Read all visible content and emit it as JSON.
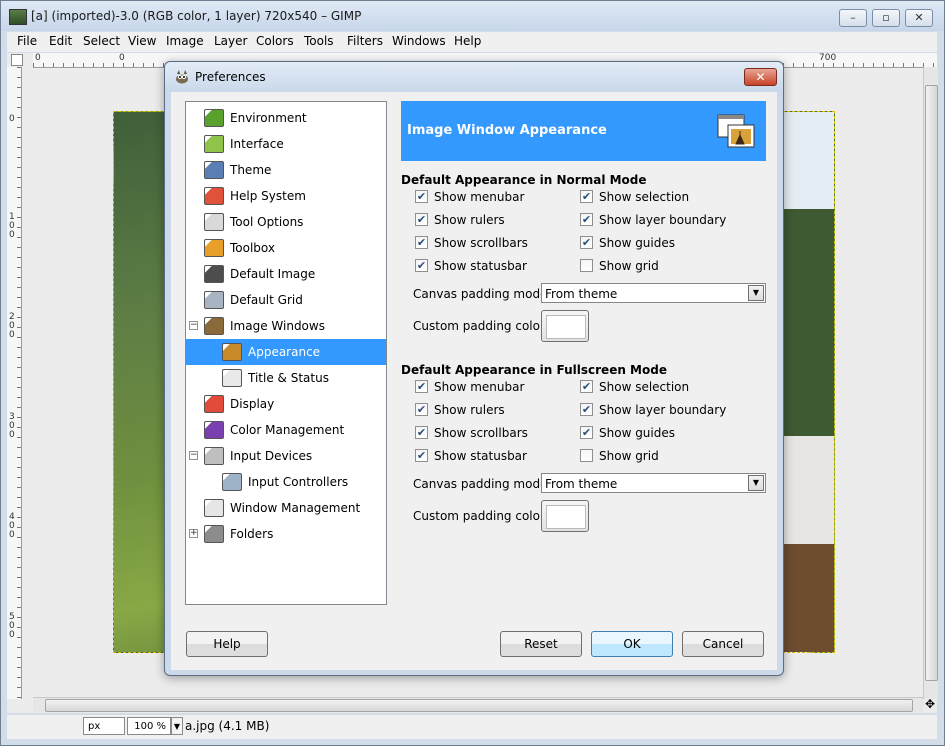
{
  "window": {
    "title": "[a] (imported)-3.0 (RGB color, 1 layer) 720x540 – GIMP",
    "minimize": "–",
    "maximize": "▫",
    "close": "✕"
  },
  "menubar": [
    "File",
    "Edit",
    "Select",
    "View",
    "Image",
    "Layer",
    "Colors",
    "Tools",
    "Filters",
    "Windows",
    "Help"
  ],
  "ruler": {
    "h_ticks": [
      "0",
      "0",
      "700"
    ],
    "v_ticks": [
      "0",
      "100",
      "200",
      "300",
      "400",
      "500"
    ]
  },
  "statusbar": {
    "unit": "px",
    "zoom": "100 %",
    "file_info": "a.jpg (4.1 MB)"
  },
  "dialog": {
    "title": "Preferences",
    "close": "✕",
    "tree": [
      {
        "label": "Environment",
        "level": 0,
        "icon": "environment-icon",
        "color": "#5aa02c"
      },
      {
        "label": "Interface",
        "level": 0,
        "icon": "interface-icon",
        "color": "#8fc34a"
      },
      {
        "label": "Theme",
        "level": 0,
        "icon": "theme-icon",
        "color": "#5b7fb5"
      },
      {
        "label": "Help System",
        "level": 0,
        "icon": "help-system-icon",
        "color": "#e0523a"
      },
      {
        "label": "Tool Options",
        "level": 0,
        "icon": "tool-options-icon",
        "color": "#d9d9d9"
      },
      {
        "label": "Toolbox",
        "level": 0,
        "icon": "toolbox-icon",
        "color": "#e8a02a"
      },
      {
        "label": "Default Image",
        "level": 0,
        "icon": "default-image-icon",
        "color": "#4d4d4d"
      },
      {
        "label": "Default Grid",
        "level": 0,
        "icon": "default-grid-icon",
        "color": "#a9b4c2"
      },
      {
        "label": "Image Windows",
        "level": 0,
        "expander": "−",
        "icon": "image-windows-icon",
        "color": "#8a6a3a"
      },
      {
        "label": "Appearance",
        "level": 1,
        "selected": true,
        "icon": "appearance-icon",
        "color": "#c98a2a"
      },
      {
        "label": "Title & Status",
        "level": 1,
        "icon": "title-status-icon",
        "color": "#e9e9e9"
      },
      {
        "label": "Display",
        "level": 0,
        "icon": "display-icon",
        "color": "#e24a3a"
      },
      {
        "label": "Color Management",
        "level": 0,
        "icon": "color-management-icon",
        "color": "#7a3fb0"
      },
      {
        "label": "Input Devices",
        "level": 0,
        "expander": "−",
        "icon": "input-devices-icon",
        "color": "#bfbfbf"
      },
      {
        "label": "Input Controllers",
        "level": 1,
        "icon": "input-controllers-icon",
        "color": "#9fb3c8"
      },
      {
        "label": "Window Management",
        "level": 0,
        "icon": "window-management-icon",
        "color": "#e6e6e6"
      },
      {
        "label": "Folders",
        "level": 0,
        "expander": "+",
        "icon": "folders-icon",
        "color": "#8c8c8c"
      }
    ],
    "banner_title": "Image Window Appearance",
    "sections": [
      {
        "heading": "Default Appearance in Normal Mode",
        "checks": [
          {
            "label": "Show menubar",
            "checked": true
          },
          {
            "label": "Show selection",
            "checked": true
          },
          {
            "label": "Show rulers",
            "checked": true
          },
          {
            "label": "Show layer boundary",
            "checked": true
          },
          {
            "label": "Show scrollbars",
            "checked": true
          },
          {
            "label": "Show guides",
            "checked": true
          },
          {
            "label": "Show statusbar",
            "checked": true
          },
          {
            "label": "Show grid",
            "checked": false
          }
        ],
        "padding_mode_label": "Canvas padding mode:",
        "padding_mode_value": "From theme",
        "padding_color_label": "Custom padding color:"
      },
      {
        "heading": "Default Appearance in Fullscreen Mode",
        "checks": [
          {
            "label": "Show menubar",
            "checked": true
          },
          {
            "label": "Show selection",
            "checked": true
          },
          {
            "label": "Show rulers",
            "checked": true
          },
          {
            "label": "Show layer boundary",
            "checked": true
          },
          {
            "label": "Show scrollbars",
            "checked": true
          },
          {
            "label": "Show guides",
            "checked": true
          },
          {
            "label": "Show statusbar",
            "checked": true
          },
          {
            "label": "Show grid",
            "checked": false
          }
        ],
        "padding_mode_label": "Canvas padding mode:",
        "padding_mode_value": "From theme",
        "padding_color_label": "Custom padding color:"
      }
    ],
    "buttons": {
      "help": "Help",
      "reset": "Reset",
      "ok": "OK",
      "cancel": "Cancel"
    },
    "colors": {
      "selection": "#3399ff",
      "banner": "#3399ff"
    }
  }
}
